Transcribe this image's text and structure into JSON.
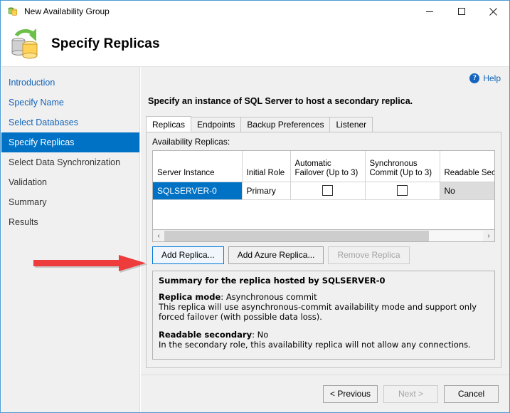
{
  "window": {
    "title": "New Availability Group",
    "title_icon": "availability-group-icon",
    "minimize_label": "—",
    "maximize_label": "□",
    "close_label": "✕"
  },
  "header": {
    "title": "Specify Replicas",
    "icon": "database-replica-icon"
  },
  "sidebar": {
    "items": [
      {
        "label": "Introduction",
        "state": "done"
      },
      {
        "label": "Specify Name",
        "state": "done"
      },
      {
        "label": "Select Databases",
        "state": "done"
      },
      {
        "label": "Specify Replicas",
        "state": "selected"
      },
      {
        "label": "Select Data Synchronization",
        "state": "plain"
      },
      {
        "label": "Validation",
        "state": "plain"
      },
      {
        "label": "Summary",
        "state": "plain"
      },
      {
        "label": "Results",
        "state": "plain"
      }
    ]
  },
  "main": {
    "help_label": "Help",
    "help_icon": "help-question-icon",
    "instruction": "Specify an instance of SQL Server to host a secondary replica.",
    "tabs": [
      {
        "label": "Replicas",
        "active": true
      },
      {
        "label": "Endpoints",
        "active": false
      },
      {
        "label": "Backup Preferences",
        "active": false
      },
      {
        "label": "Listener",
        "active": false
      }
    ],
    "grid_label": "Availability Replicas:",
    "grid": {
      "columns": [
        "Server Instance",
        "Initial Role",
        "Automatic Failover (Up to 3)",
        "Synchronous Commit (Up to 3)",
        "Readable Seco"
      ],
      "rows": [
        {
          "server_instance": "SQLSERVER-0",
          "initial_role": "Primary",
          "automatic_failover": false,
          "synchronous_commit": false,
          "readable_secondary": "No",
          "selected": true
        }
      ]
    },
    "scrollbar": {
      "left_arrow": "‹",
      "right_arrow": "›"
    },
    "buttons": [
      {
        "label": "Add Replica...",
        "state": "focus"
      },
      {
        "label": "Add Azure Replica...",
        "state": "normal"
      },
      {
        "label": "Remove Replica",
        "state": "disabled"
      }
    ],
    "summary": {
      "title": "Summary for the replica hosted by SQLSERVER-0",
      "replica_mode_label": "Replica mode",
      "replica_mode_value": "Asynchronous commit",
      "replica_mode_desc": "This replica will use asynchronous-commit availability mode and support only forced failover (with possible data loss).",
      "readable_secondary_label": "Readable secondary",
      "readable_secondary_value": "No",
      "readable_secondary_desc": "In the secondary role, this availability replica will not allow any connections."
    }
  },
  "footer": {
    "previous_label": "< Previous",
    "next_label": "Next >",
    "cancel_label": "Cancel"
  },
  "annotation": {
    "arrow_color": "#ee3b3b",
    "points_to": "Add Replica..."
  }
}
